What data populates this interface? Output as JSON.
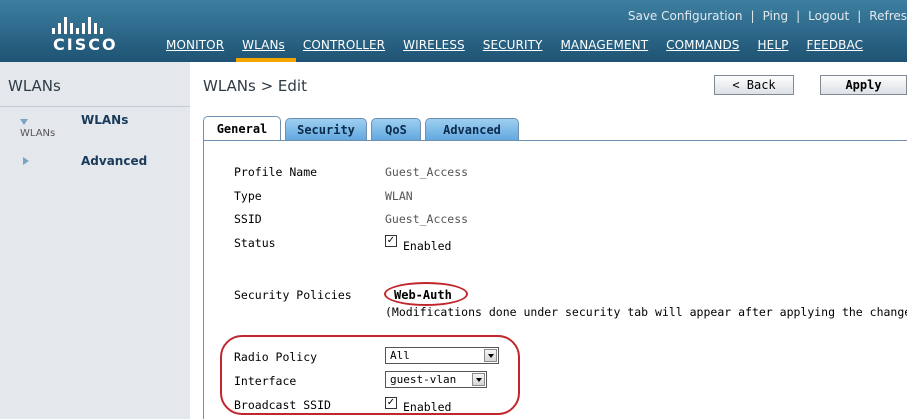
{
  "header": {
    "brand": "CISCO",
    "utility_links": [
      "Save Configuration",
      "Ping",
      "Logout",
      "Refres"
    ],
    "nav": [
      "MONITOR",
      "WLANs",
      "CONTROLLER",
      "WIRELESS",
      "SECURITY",
      "MANAGEMENT",
      "COMMANDS",
      "HELP",
      "FEEDBAC"
    ],
    "active_nav": "WLANs",
    "accent_color": "#f5a500"
  },
  "sidebar": {
    "title": "WLANs",
    "items": [
      {
        "label": "WLANs",
        "sub": "WLANs",
        "icon": "arrow-down-icon"
      },
      {
        "label": "Advanced",
        "icon": "arrow-right-icon"
      }
    ]
  },
  "page": {
    "breadcrumb": "WLANs > Edit",
    "back_label": "< Back",
    "apply_label": "Apply"
  },
  "tabs": [
    {
      "label": "General",
      "active": true
    },
    {
      "label": "Security",
      "active": false
    },
    {
      "label": "QoS",
      "active": false
    },
    {
      "label": "Advanced",
      "active": false
    }
  ],
  "general": {
    "profile_name_label": "Profile Name",
    "profile_name_value": "Guest_Access",
    "type_label": "Type",
    "type_value": "WLAN",
    "ssid_label": "SSID",
    "ssid_value": "Guest_Access",
    "status_label": "Status",
    "status_checked": true,
    "status_text": "Enabled",
    "security_policies_label": "Security Policies",
    "security_policies_value": "Web-Auth",
    "security_note": "(Modifications done under security tab will appear after applying the changes.)",
    "radio_policy_label": "Radio Policy",
    "radio_policy_value": "All",
    "interface_label": "Interface",
    "interface_value": "guest-vlan",
    "broadcast_ssid_label": "Broadcast SSID",
    "broadcast_checked": true,
    "broadcast_text": "Enabled"
  },
  "colors": {
    "header_blue": "#2f6b8d",
    "sidebar_bg": "#e4e8ed",
    "tab_blue": "#62a8e0",
    "highlight_red": "#c0272d"
  }
}
